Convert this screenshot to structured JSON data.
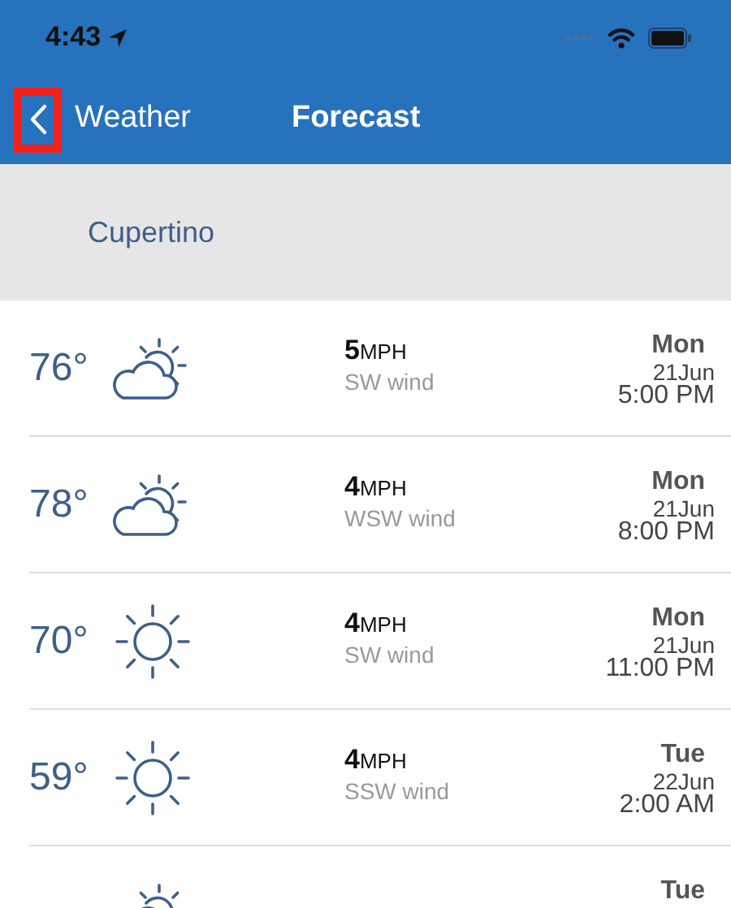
{
  "status_bar": {
    "time": "4:43"
  },
  "nav": {
    "back_label": "Weather",
    "back_highlighted": true,
    "title": "Forecast"
  },
  "location": "Cupertino",
  "forecasts": [
    {
      "temperature": "76°",
      "kind": "partly_cloudy",
      "speed": "5",
      "unit": "MPH",
      "wind": "SW wind",
      "day": "Mon",
      "date": "21Jun",
      "time": "5:00 PM"
    },
    {
      "temperature": "78°",
      "kind": "partly_cloudy",
      "speed": "4",
      "unit": "MPH",
      "wind": "WSW wind",
      "day": "Mon",
      "date": "21Jun",
      "time": "8:00 PM"
    },
    {
      "temperature": "70°",
      "kind": "sunny",
      "speed": "4",
      "unit": "MPH",
      "wind": "SW wind",
      "day": "Mon",
      "date": "21Jun",
      "time": "11:00 PM"
    },
    {
      "temperature": "59°",
      "kind": "sunny",
      "speed": "4",
      "unit": "MPH",
      "wind": "SSW wind",
      "day": "Tue",
      "date": "22Jun",
      "time": "2:00 AM"
    },
    {
      "kind": "partly_cloudy",
      "day": "Tue"
    }
  ]
}
